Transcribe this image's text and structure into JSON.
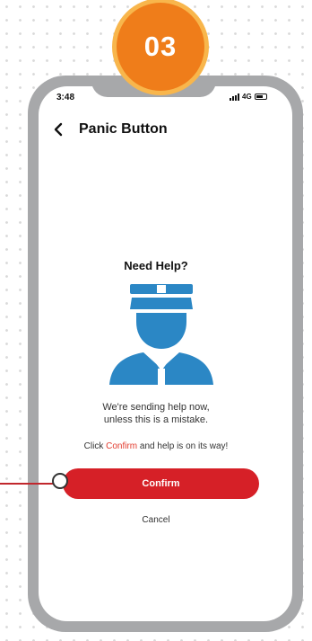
{
  "step_badge": {
    "number": "03"
  },
  "status_bar": {
    "time": "3:48",
    "network": "4G"
  },
  "header": {
    "title": "Panic Button"
  },
  "content": {
    "heading": "Need Help?",
    "message_line1": "We're sending help now,",
    "message_line2": "unless this is a mistake.",
    "instruction_before": "Click ",
    "instruction_highlight": "Confirm",
    "instruction_after": " and help is on its way!"
  },
  "actions": {
    "confirm_label": "Confirm",
    "cancel_label": "Cancel"
  },
  "icons": [
    "chevron-left-icon",
    "police-officer-icon",
    "signal-icon",
    "battery-icon"
  ],
  "colors": {
    "badge": "#ef7d1a",
    "badge_ring": "#f8b64c",
    "confirm_button": "#d62027",
    "highlight_text": "#e23b2e",
    "officer_icon": "#2b87c5",
    "phone_frame": "#a7a8aa"
  }
}
